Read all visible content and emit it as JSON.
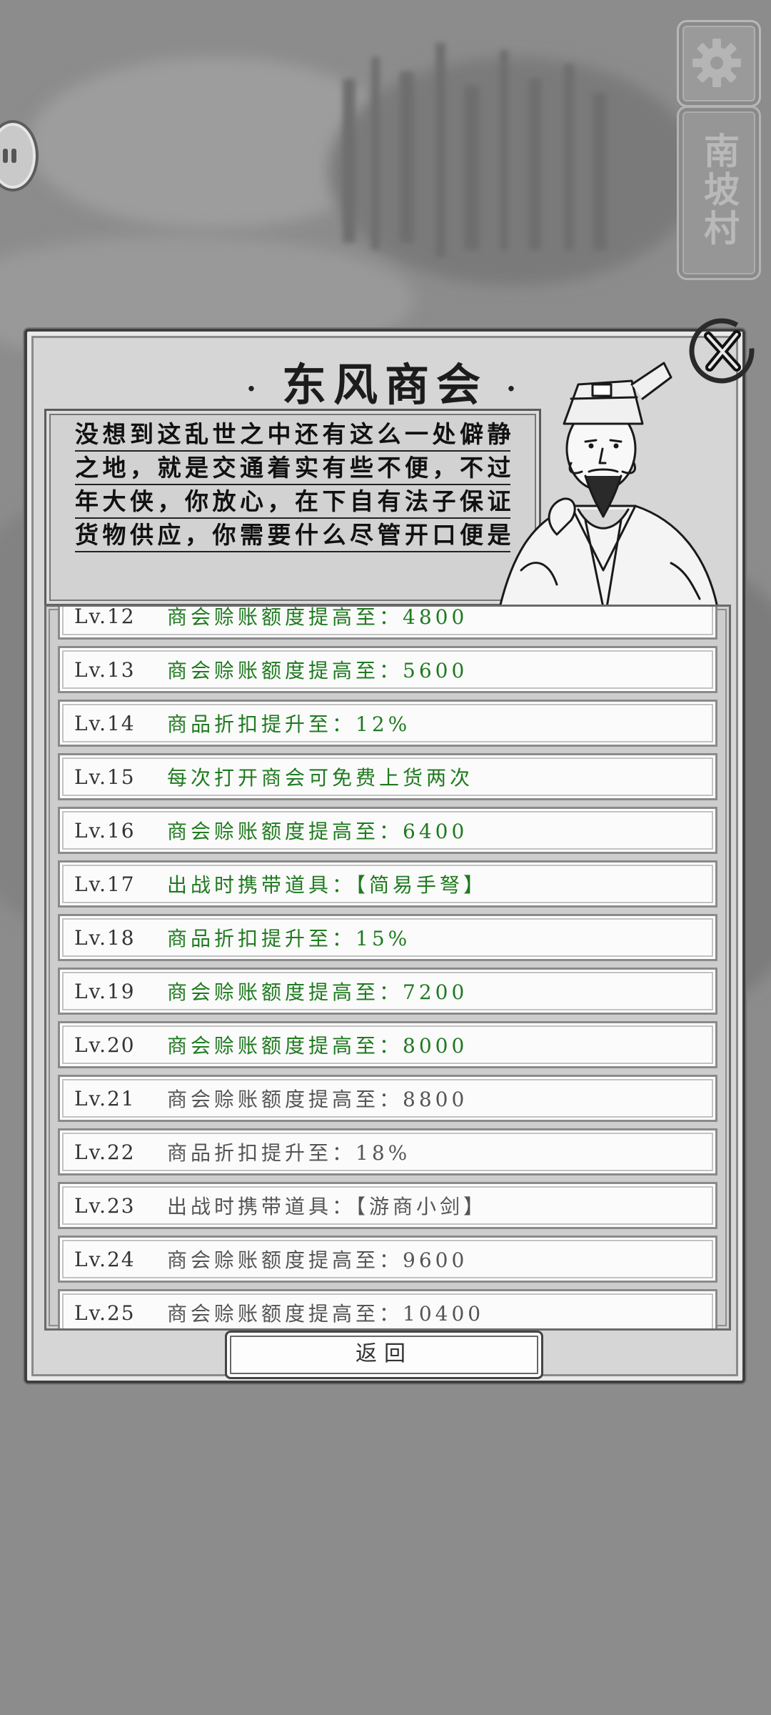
{
  "location": "南坡村",
  "dialog": {
    "title": "东风商会",
    "speech_lines": [
      "没想到这乱世之中还有这么一处僻静",
      "之地，就是交通着实有些不便，不过",
      "年大侠，你放心，在下自有法子保证",
      "货物供应，你需要什么尽管开口便是"
    ],
    "back_label": "返回"
  },
  "levels": [
    {
      "lv": "Lv.12",
      "text": "商会赊账额度提高至：4800",
      "unlocked": true
    },
    {
      "lv": "Lv.13",
      "text": "商会赊账额度提高至：5600",
      "unlocked": true
    },
    {
      "lv": "Lv.14",
      "text": "商品折扣提升至：12%",
      "unlocked": true
    },
    {
      "lv": "Lv.15",
      "text": "每次打开商会可免费上货两次",
      "unlocked": true
    },
    {
      "lv": "Lv.16",
      "text": "商会赊账额度提高至：6400",
      "unlocked": true
    },
    {
      "lv": "Lv.17",
      "text": "出战时携带道具：【简易手弩】",
      "unlocked": true
    },
    {
      "lv": "Lv.18",
      "text": "商品折扣提升至：15%",
      "unlocked": true
    },
    {
      "lv": "Lv.19",
      "text": "商会赊账额度提高至：7200",
      "unlocked": true
    },
    {
      "lv": "Lv.20",
      "text": "商会赊账额度提高至：8000",
      "unlocked": true
    },
    {
      "lv": "Lv.21",
      "text": "商会赊账额度提高至：8800",
      "unlocked": false
    },
    {
      "lv": "Lv.22",
      "text": "商品折扣提升至：18%",
      "unlocked": false
    },
    {
      "lv": "Lv.23",
      "text": "出战时携带道具：【游商小剑】",
      "unlocked": false
    },
    {
      "lv": "Lv.24",
      "text": "商会赊账额度提高至：9600",
      "unlocked": false
    },
    {
      "lv": "Lv.25",
      "text": "商会赊账额度提高至：10400",
      "unlocked": false
    }
  ],
  "colors": {
    "unlocked_text": "#1f7a1f",
    "locked_text": "#555555"
  },
  "icons": {
    "settings": "gear-icon",
    "close": "close-icon",
    "pause": "pause-icon"
  }
}
